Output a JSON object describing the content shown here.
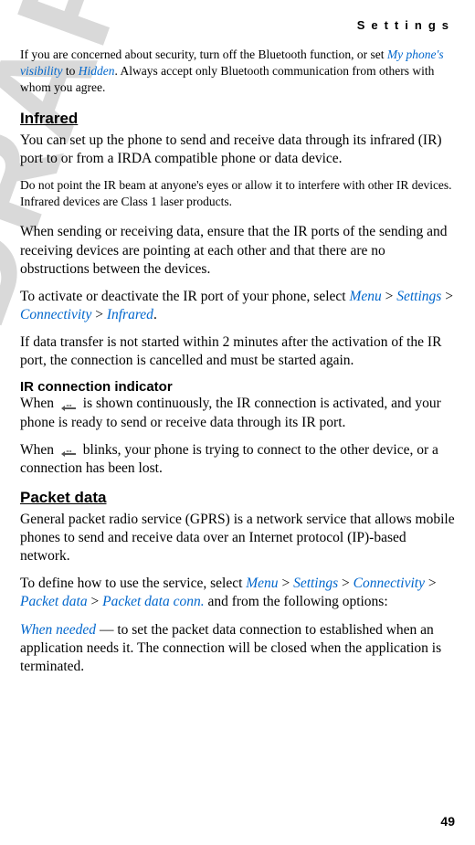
{
  "header": "Settings",
  "watermark": "DRAFT",
  "intro": {
    "t1": "If you are concerned about security, turn off the Bluetooth function, or set ",
    "link1": "My phone's visibility",
    "t2": " to ",
    "link2": "Hidden",
    "t3": ". Always accept only Bluetooth communication from others with whom you agree."
  },
  "infrared": {
    "heading": "Infrared",
    "p1": "You can set up the phone to send and receive data through its infrared (IR) port to or from a IRDA compatible phone or data device.",
    "p2": "Do not point the IR beam at anyone's eyes or allow it to interfere with other IR devices. Infrared devices are Class 1 laser products.",
    "p3": "When sending or receiving data, ensure that the IR ports of the sending and receiving devices are pointing at each other and that there are no obstructions between the devices.",
    "p4_t1": "To activate or deactivate the IR port of your phone, select ",
    "p4_menu": "Menu",
    "p4_gt1": " > ",
    "p4_settings": "Settings",
    "p4_gt2": " > ",
    "p4_conn": "Connectivity",
    "p4_gt3": " > ",
    "p4_ir": "Infrared",
    "p4_end": ".",
    "p5": "If data transfer is not started within 2 minutes after the activation of the IR port, the connection is cancelled and must be started again."
  },
  "irconn": {
    "heading": "IR connection indicator",
    "p1_a": "When ",
    "p1_b": " is shown continuously, the IR connection is activated, and your phone is ready to send or receive data through its IR port.",
    "p2_a": "When ",
    "p2_b": " blinks, your phone is trying to connect to the other device, or a connection has been lost."
  },
  "packet": {
    "heading": "Packet data",
    "p1": "General packet radio service (GPRS) is a network service that allows mobile phones to send and receive data over an Internet protocol (IP)-based network.",
    "p2_t1": "To define how to use the service, select ",
    "p2_menu": "Menu",
    "p2_gt1": " > ",
    "p2_settings": "Settings",
    "p2_gt2": " > ",
    "p2_conn": "Connectivity",
    "p2_gt3": " > ",
    "p2_pd": "Packet data",
    "p2_gt4": " > ",
    "p2_pdc": "Packet data conn.",
    "p2_end": " and from the following options:",
    "p3_link": "When needed",
    "p3_text": " — to set the packet data connection to established when an application needs it. The connection will be closed when the application is terminated."
  },
  "page_num": "49"
}
